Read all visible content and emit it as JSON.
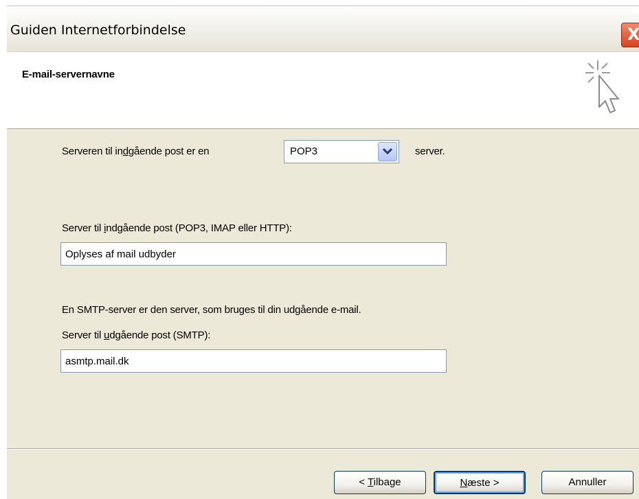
{
  "window": {
    "title": "Guiden Internetforbindelse",
    "close_symbol": "X"
  },
  "header": {
    "title": "E-mail-servernavne",
    "icon": "wizard-cursor-sparkle-icon"
  },
  "form": {
    "server_type_prefix": "Serveren til in",
    "server_type_accel": "d",
    "server_type_suffix": "gående post er en",
    "server_type_value": "POP3",
    "server_type_after": "server.",
    "incoming_label_prefix": "Server til ",
    "incoming_label_accel": "i",
    "incoming_label_suffix": "ndgående post (POP3, IMAP eller HTTP):",
    "incoming_value": "Oplyses af mail udbyder",
    "smtp_info": "En SMTP-server er den server, som bruges til din udgående e-mail.",
    "outgoing_label_prefix": "Server til ",
    "outgoing_label_accel": "u",
    "outgoing_label_suffix": "dgående post (SMTP):",
    "outgoing_value": "asmtp.mail.dk"
  },
  "buttons": {
    "back_prefix": "< ",
    "back_accel": "T",
    "back_suffix": "ilbage",
    "next_accel": "N",
    "next_suffix": "æste >",
    "cancel": "Annuller"
  },
  "colors": {
    "dialog_background": "#ece9d8",
    "close_button": "#d2451f",
    "field_border": "#7f9db9",
    "button_border": "#003c74"
  }
}
